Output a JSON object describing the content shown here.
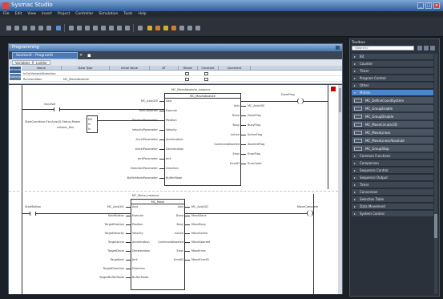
{
  "app": {
    "title": "Sysmac Studio",
    "menu": [
      "File",
      "Edit",
      "View",
      "Insert",
      "Project",
      "Controller",
      "Simulation",
      "Tools",
      "Help"
    ]
  },
  "editor": {
    "pane_title": "Programming",
    "tab_label": "Section0 - Program0",
    "subtabs": [
      "Variables",
      "Ladder"
    ]
  },
  "variable_table": {
    "side_labels": [
      "Internals",
      "Externals"
    ],
    "headers": [
      "Name",
      "Data Type",
      "Initial Value",
      "AT",
      "Retain",
      "Constant",
      "Comment"
    ],
    "rows": [
      {
        "name": "InOutVariableDetection",
        "type": ""
      },
      {
        "name": "RunCondition",
        "type": "MC_MoveAbsolute"
      }
    ]
  },
  "ladder": {
    "rung1": {
      "fb_instance": "MC_MoveAbsolute_instance",
      "fb_name": "MC_MoveAbsolute",
      "left_contact": "InputVar",
      "left_arg_main": "StartCondition.Ext.Axis(0).Status.Power",
      "left_arg_sub": "InitAxis_Run",
      "left_pins": [
        "Axis",
        "Execute",
        "Position",
        "Velocity",
        "Acceleration",
        "Deceleration",
        "Jerk",
        "Direction",
        "BufferMode"
      ],
      "left_args": [
        "MC_Axis000",
        "RunCondition",
        "PositionParameter",
        "VelocityParameter",
        "AccelParameter",
        "DecelParameter",
        "JerkParameter",
        "DirectionParameter",
        "BufferModeParameter"
      ],
      "right_pins": [
        "Axis",
        "Done",
        "Busy",
        "Active",
        "CommandAborted",
        "Error",
        "ErrorID"
      ],
      "right_args": [
        "MC_Axis000",
        "DoneFlag",
        "BusyFlag",
        "ActiveFlag",
        "AbortedFlag",
        "ErrorFlag",
        "ErrorCode"
      ],
      "coil": "DoneFlag"
    },
    "rung2": {
      "fb_instance": "MC_Move_instance",
      "fb_name": "MC_Move",
      "left_contact": "StartButton",
      "left_pins": [
        "Axis",
        "Execute",
        "Position",
        "Velocity",
        "Acceleration",
        "Deceleration",
        "Jerk",
        "Direction",
        "BufferMode"
      ],
      "left_args": [
        "MC_Axis001",
        "StartButton",
        "TargetPosition",
        "TargetVelocity",
        "TargetAccel",
        "TargetDecel",
        "TargetJerk",
        "TargetDirection",
        "TargetBufferMode"
      ],
      "right_pins": [
        "Axis",
        "Done",
        "Busy",
        "Active",
        "CommandAborted",
        "Error",
        "ErrorID"
      ],
      "right_args": [
        "MC_Axis001",
        "MoveDone",
        "MoveBusy",
        "MoveActive",
        "MoveAborted",
        "MoveError",
        "MoveErrorID"
      ],
      "coil": "MoveComplete"
    }
  },
  "toolbox": {
    "title": "Toolbox",
    "search_placeholder": "<Search>",
    "categories": [
      {
        "label": "Bit",
        "selected": false
      },
      {
        "label": "Counter",
        "selected": false
      },
      {
        "label": "Timer",
        "selected": false
      },
      {
        "label": "Program Control",
        "selected": false
      },
      {
        "label": "Other",
        "selected": false
      },
      {
        "label": "Motion",
        "selected": true
      }
    ],
    "motion_items": [
      "MC_DefineCoordSystem",
      "MC_GroupEnable",
      "MC_GroupDisable",
      "MC_MoveCircular2D",
      "MC_MoveLinear",
      "MC_MoveLinearAbsolute",
      "MC_GroupStop"
    ],
    "categories_after": [
      "Common Functions",
      "Comparison",
      "Sequence Control",
      "Sequence Output",
      "Timer",
      "Conversion",
      "Selection Table",
      "Data Movement",
      "System Control"
    ]
  },
  "colors": {
    "accent": "#4a86c9",
    "titlebar": "#2d5c98"
  }
}
